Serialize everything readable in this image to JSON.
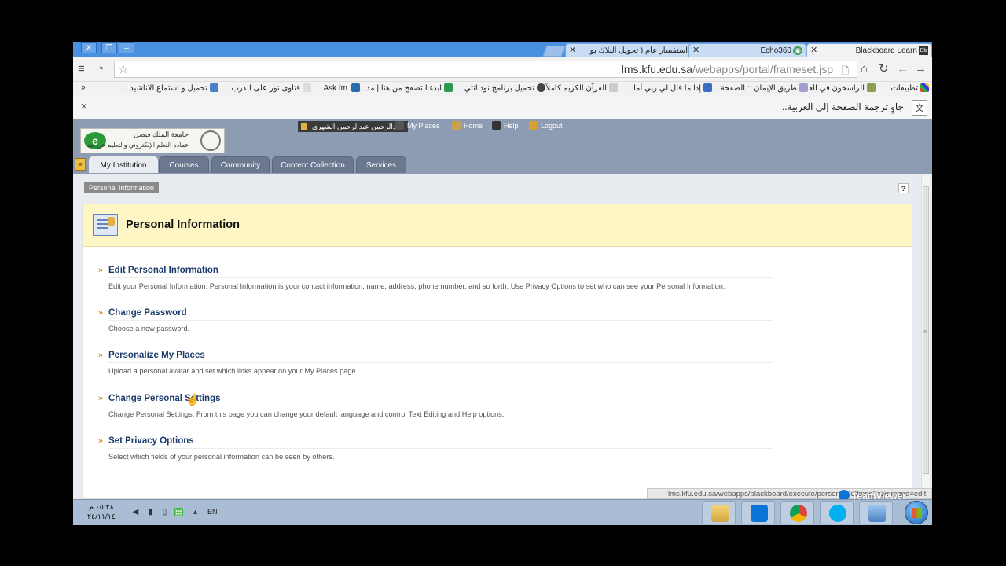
{
  "browser": {
    "tabs": [
      {
        "label": "Blackboard Learn",
        "icon": "blackboard-icon",
        "active": true
      },
      {
        "label": "Echo360",
        "icon": "echo360-icon",
        "active": false
      },
      {
        "label": "استفسار عام ( تحويل البلاك بو",
        "icon": "forum-icon",
        "active": false
      }
    ],
    "url_host": "lms.kfu.edu.sa",
    "url_path": "/webapps/portal/frameset.jsp",
    "bookmarks": [
      {
        "label": "تطبيقات",
        "icon": "apps-icon"
      },
      {
        "label": "الراسخون في العلم ...",
        "icon": "bookmark-icon"
      },
      {
        "label": "طريق الإيمان :: الصفحة ...",
        "icon": "bookmark-icon"
      },
      {
        "label": "إذا ما قال لي ربي أما ...",
        "icon": "bookmark-icon"
      },
      {
        "label": "القرآن الكريم كاملاً",
        "icon": "page-icon"
      },
      {
        "label": "تحميل برنامج نود انتي ...",
        "icon": "bookmark-icon"
      },
      {
        "label": "ابدء التصفح من هنا | مد...",
        "icon": "bookmark-icon"
      },
      {
        "label": "Ask.fm",
        "icon": "askfm-icon"
      },
      {
        "label": "فتاوى نور على الدرب ...",
        "icon": "page-icon"
      },
      {
        "label": "تحميل و استماع الاناشيد ...",
        "icon": "bookmark-icon"
      }
    ],
    "bookmarks_overflow": "»",
    "translate_text": "جاوِ ترجمة الصفحة إلى العربية..",
    "status_url": "lms.kfu.edu.sa/webapps/blackboard/execute/personalSettings?command=edit"
  },
  "bb": {
    "logo": {
      "line1": "جامعة الملك فيصل",
      "line2": "عمادة التعلم الإلكتروني والتعليم عن بعد",
      "mark": "e"
    },
    "user_name": "عبدالرحمن عبدالرحمن الشهري",
    "top_links": [
      {
        "label": "My Places",
        "icon": "my-places-icon"
      },
      {
        "label": "Home",
        "icon": "home-icon"
      },
      {
        "label": "Help",
        "icon": "help-icon"
      },
      {
        "label": "Logout",
        "icon": "logout-icon"
      }
    ],
    "nav_tabs": [
      "My Institution",
      "Courses",
      "Community",
      "Content Collection",
      "Services"
    ],
    "breadcrumb": "Personal Information",
    "help_symbol": "?",
    "page_title": "Personal Information",
    "items": [
      {
        "title": "Edit Personal Information",
        "desc": "Edit your Personal Information. Personal Information is your contact information, name, address, phone number, and so forth. Use Privacy Options to set who can see your Personal Information."
      },
      {
        "title": "Change Password",
        "desc": "Choose a new password."
      },
      {
        "title": "Personalize My Places",
        "desc": "Upload a personal avatar and set which links appear on your My Places page."
      },
      {
        "title": "Change Personal Settings",
        "desc": "Change Personal Settings. From this page you can change your default language and control Text Editing and Help options."
      },
      {
        "title": "Set Privacy Options",
        "desc": "Select which fields of your personal information can be seen by others."
      }
    ],
    "bullet": "»"
  },
  "overlay": {
    "teamviewer": "TeamViewer"
  },
  "taskbar": {
    "time": "٠٥:٣٨ م",
    "date": "٢٤/١١/١٤",
    "lang": "EN",
    "apps": [
      "explorer-icon",
      "teamviewer-icon",
      "chrome-icon",
      "skype-icon",
      "network-icon"
    ]
  }
}
